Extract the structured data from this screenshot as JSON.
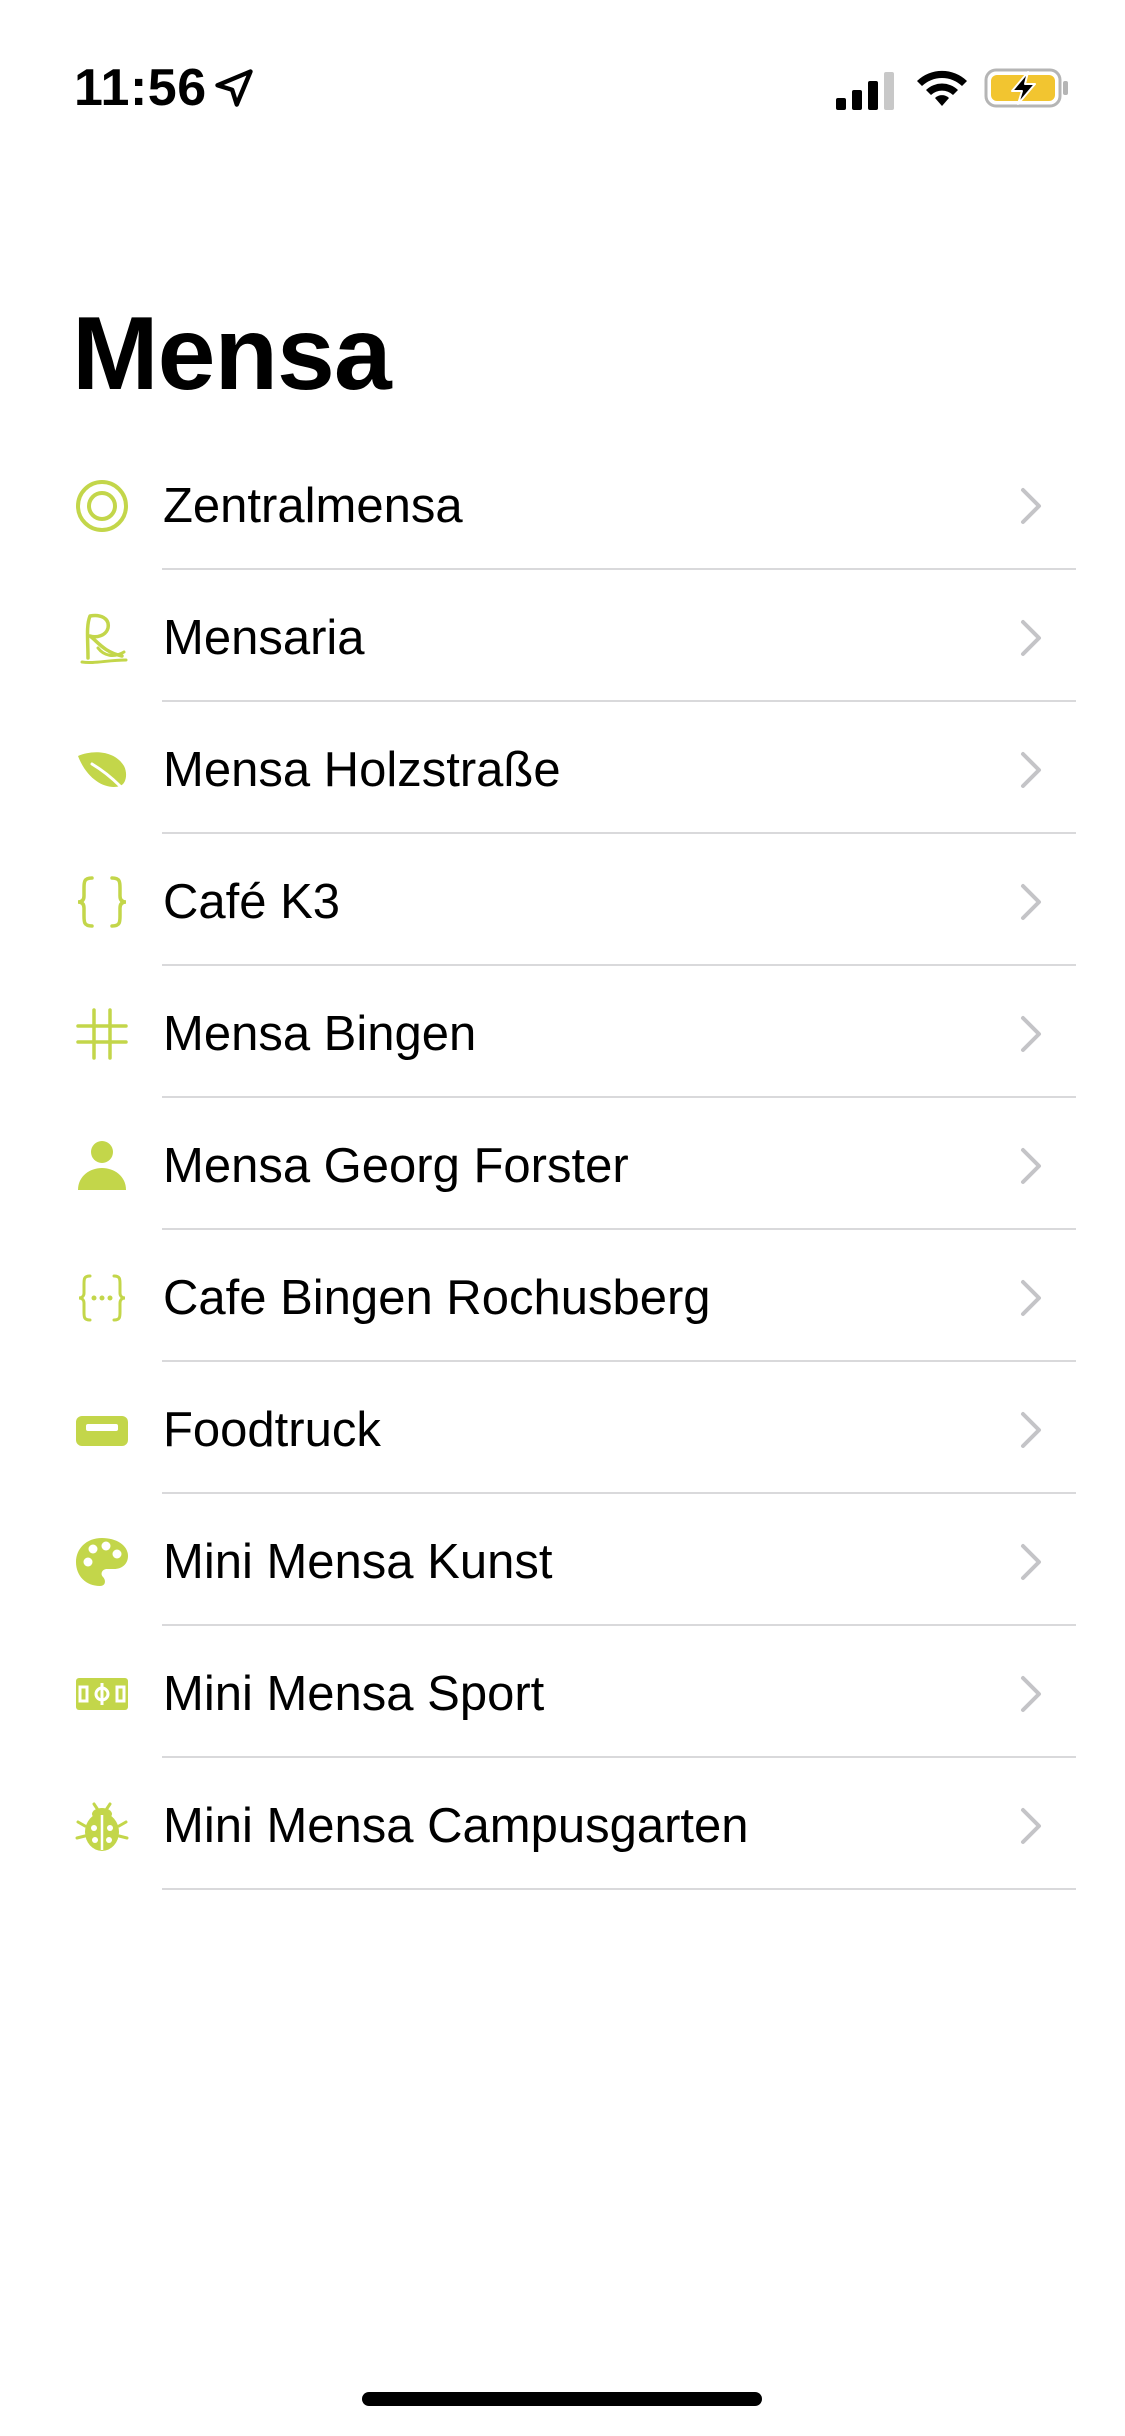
{
  "status_bar": {
    "time": "11:56",
    "location_icon": "location-arrow-icon",
    "signal_icon": "cellular-signal-icon",
    "wifi_icon": "wifi-icon",
    "battery_icon": "battery-charging-icon"
  },
  "colors": {
    "accent": "#c3d64a",
    "chevron": "#c4c4c7",
    "separator": "#d9d9db",
    "battery_fill": "#f2c530"
  },
  "header": {
    "title": "Mensa"
  },
  "list": {
    "items": [
      {
        "label": "Zentralmensa",
        "icon": "target-icon"
      },
      {
        "label": "Mensaria",
        "icon": "mensaria-logo-icon"
      },
      {
        "label": "Mensa Holzstraße",
        "icon": "leaf-icon"
      },
      {
        "label": "Café K3",
        "icon": "curly-braces-icon"
      },
      {
        "label": "Mensa Bingen",
        "icon": "hashtag-icon"
      },
      {
        "label": "Mensa Georg Forster",
        "icon": "person-icon"
      },
      {
        "label": "Cafe Bingen Rochusberg",
        "icon": "curly-braces-dots-icon"
      },
      {
        "label": "Foodtruck",
        "icon": "truck-icon"
      },
      {
        "label": "Mini Mensa Kunst",
        "icon": "palette-icon"
      },
      {
        "label": "Mini Mensa Sport",
        "icon": "sports-field-icon"
      },
      {
        "label": "Mini Mensa Campusgarten",
        "icon": "ladybug-icon"
      }
    ]
  }
}
